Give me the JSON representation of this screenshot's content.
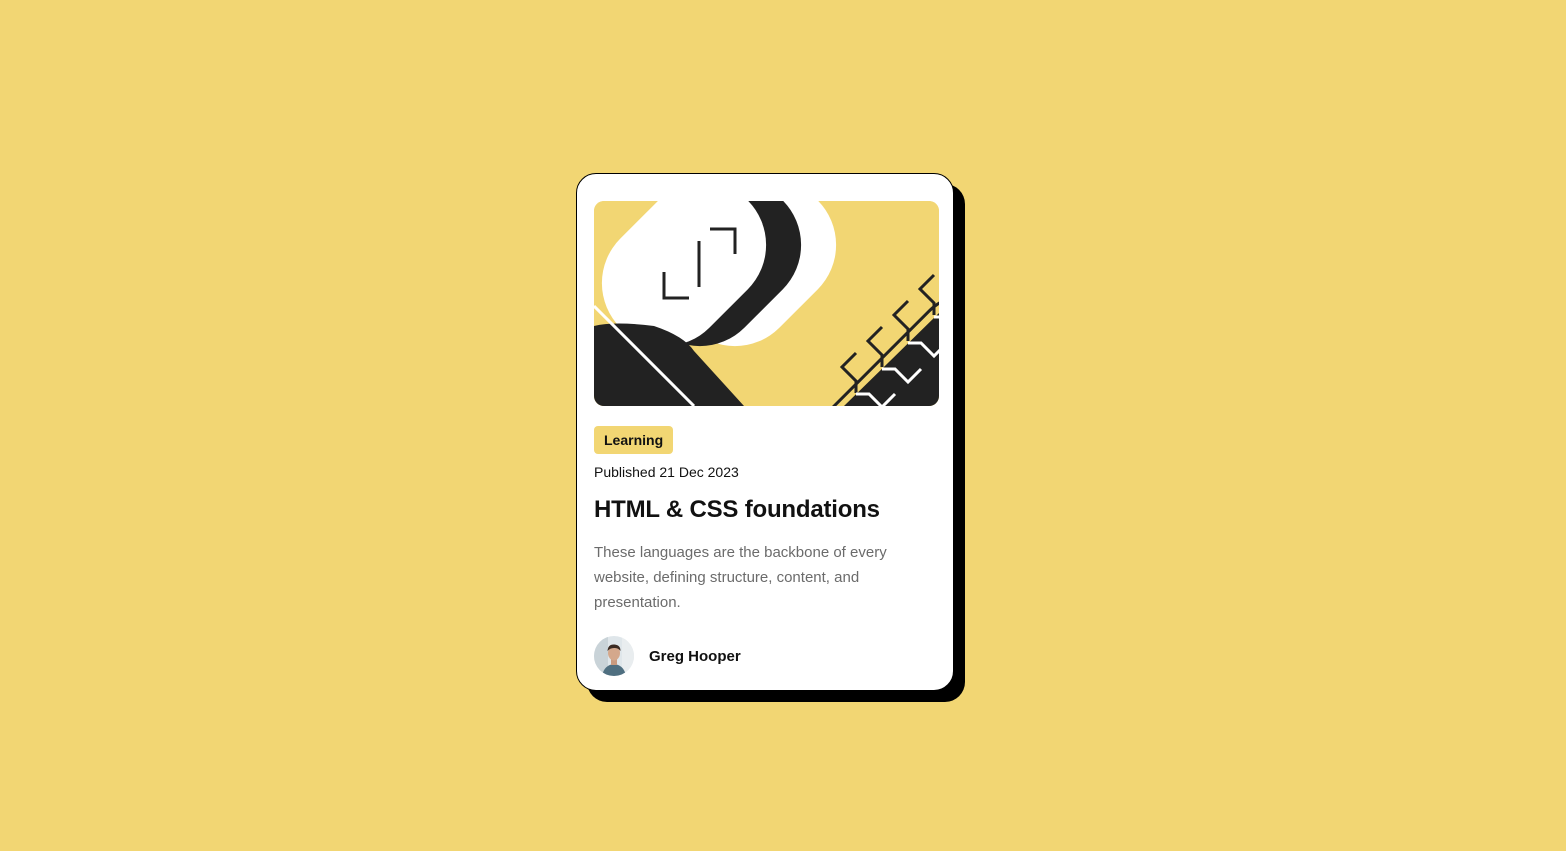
{
  "colors": {
    "background": "#f2d673",
    "card": "#ffffff",
    "shadow": "#000000",
    "heading": "#111111",
    "body_text": "#6b6b6b"
  },
  "card": {
    "tag": "Learning",
    "published": "Published 21 Dec 2023",
    "title": "HTML & CSS foundations",
    "description": "These languages are the backbone of every website, defining structure, content, and presentation.",
    "author": {
      "name": "Greg Hooper",
      "avatar_icon": "avatar-photo"
    },
    "illustration_icon": "abstract-code-illustration"
  }
}
